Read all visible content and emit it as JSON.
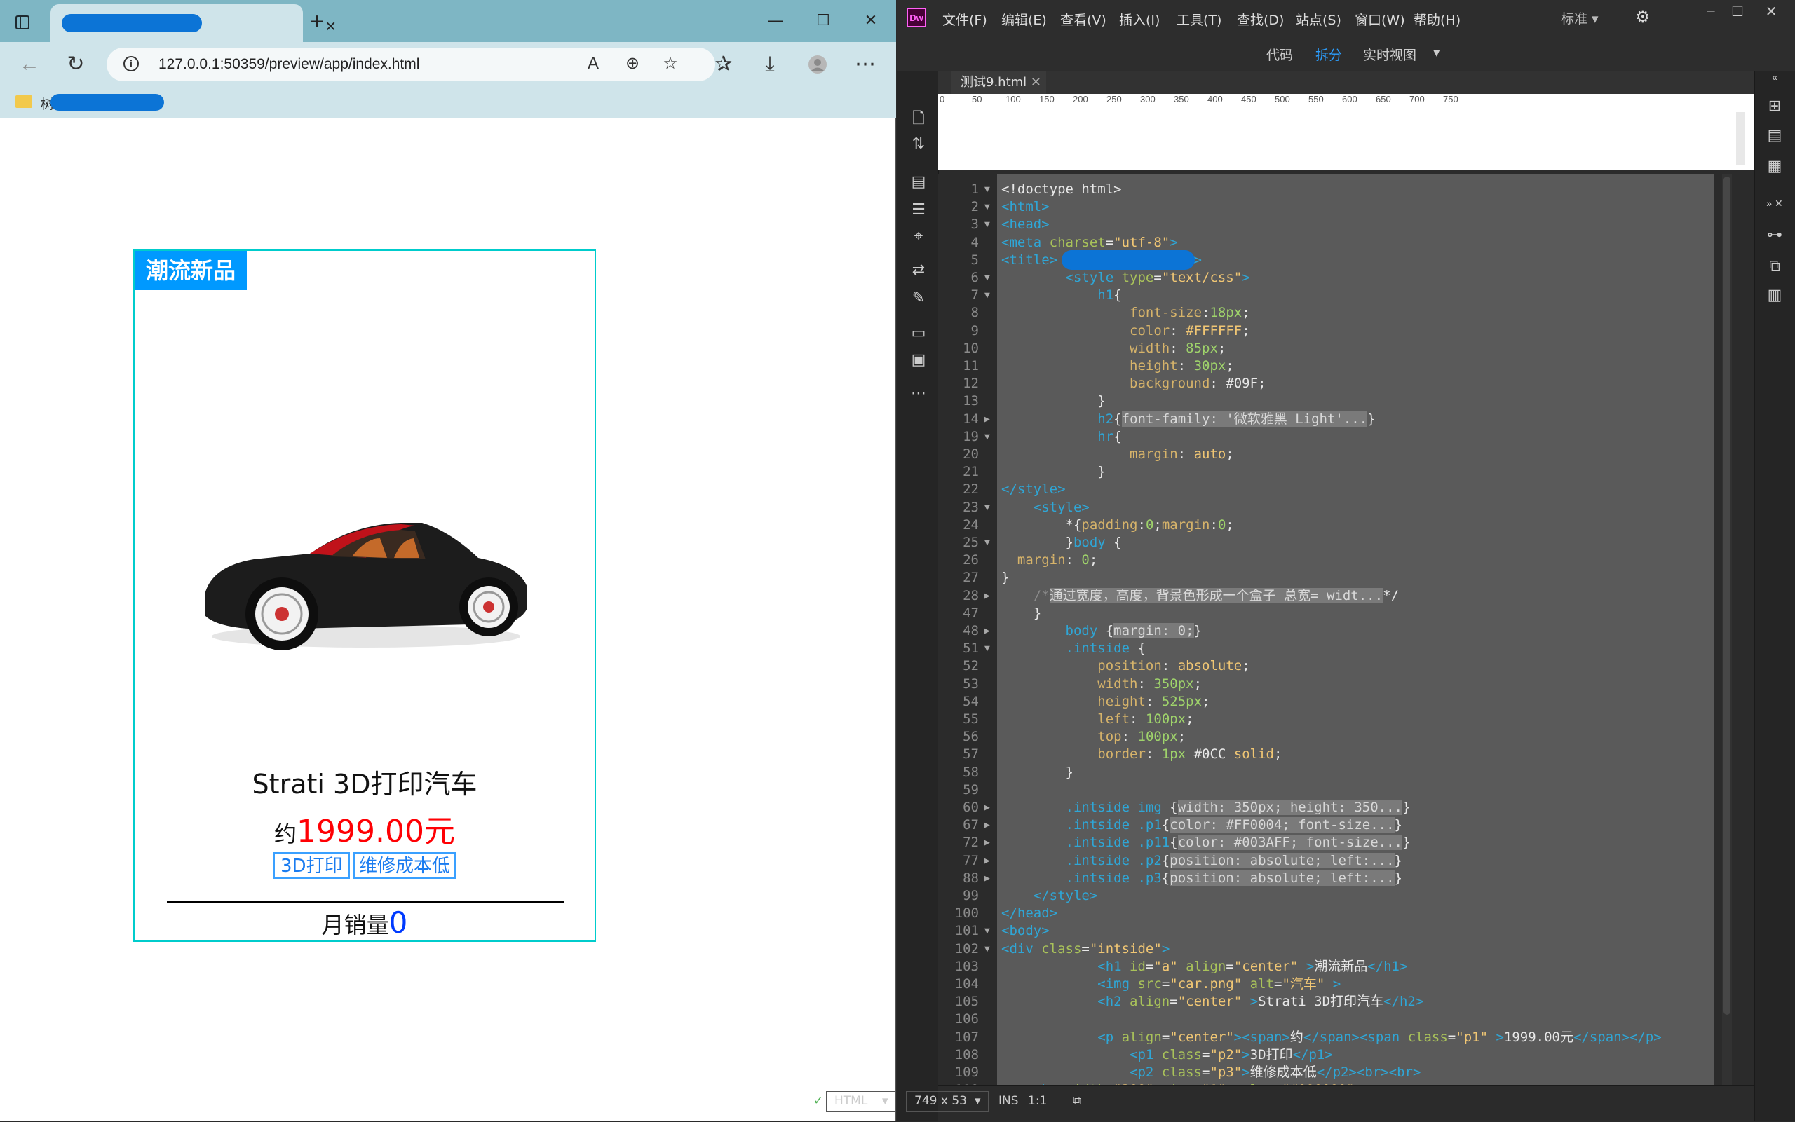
{
  "browser": {
    "url": "127.0.0.1:50359/preview/app/index.html",
    "fav_partial": "树",
    "new_tab_symbol": "+",
    "tab_close_symbol": "×"
  },
  "card": {
    "title": "潮流新品",
    "product_name": "Strati 3D打印汽车",
    "price_prefix": "约",
    "price": "1999.00元",
    "tag1": "3D打印",
    "tag2": "维修成本低",
    "sales_label": "月销量",
    "sales_count": "0",
    "image_alt": "汽车",
    "colors": {
      "title_bg": "#0099ff",
      "price": "#ff0004",
      "sales": "#003aff",
      "border": "#00cccc"
    }
  },
  "dw": {
    "logo": "Dw",
    "menus": [
      "文件(F)",
      "编辑(E)",
      "查看(V)",
      "插入(I)",
      "工具(T)",
      "查找(D)",
      "站点(S)",
      "窗口(W)",
      "帮助(H)"
    ],
    "workspace": "标准",
    "views": {
      "code": "代码",
      "split": "拆分",
      "live": "实时视图"
    },
    "doc_tab": "测试9.html",
    "ruler": [
      "0",
      "50",
      "100",
      "150",
      "200",
      "250",
      "300",
      "350",
      "400",
      "450",
      "500",
      "550",
      "600",
      "650",
      "700",
      "750"
    ],
    "status": {
      "lang": "HTML",
      "size": "749 x 53",
      "mode": "INS",
      "pos": "1:1"
    }
  }
}
